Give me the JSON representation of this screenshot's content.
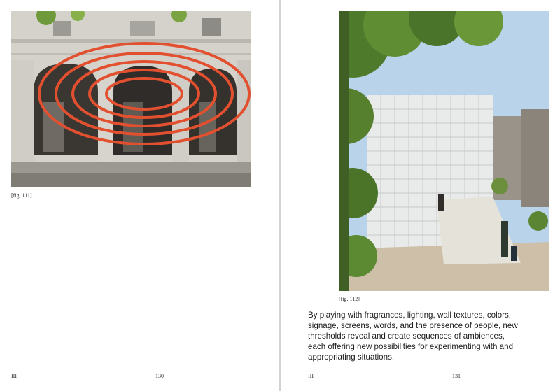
{
  "left_page": {
    "figure_caption": "[fig. 111]",
    "section_marker": "III",
    "page_number": "130"
  },
  "right_page": {
    "figure_caption": "[fig. 112]",
    "body_lines": [
      "By playing with fragrances, lighting, wall textures, colors,",
      "signage, screens, words, and the presence of people, new",
      "thresholds reveal and create sequences of ambiences,",
      "each offering new possibilities for experimenting with and",
      "appropriating situations."
    ],
    "section_marker": "III",
    "page_number": "131"
  },
  "colors": {
    "paper": "#ffffff",
    "ink": "#1a1a1a",
    "anamorphic_red": "#e2502f"
  }
}
